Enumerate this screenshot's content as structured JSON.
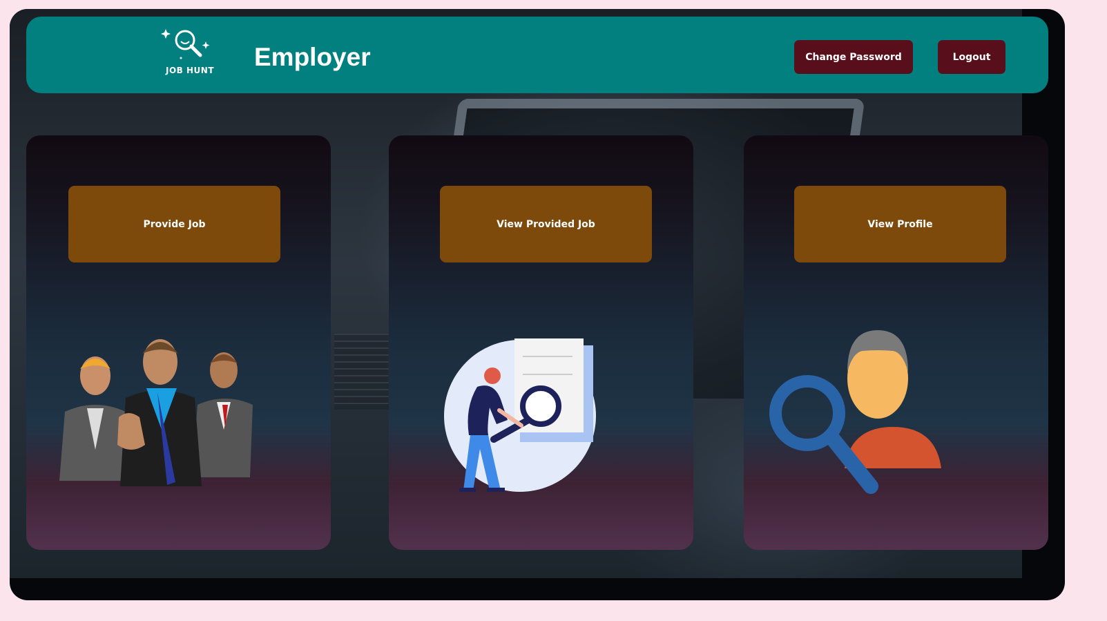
{
  "header": {
    "logo_text": "JOB HUNT",
    "title": "Employer",
    "change_password_label": "Change Password",
    "logout_label": "Logout"
  },
  "cards": [
    {
      "label": "Provide Job",
      "illustration": "business-team-icon"
    },
    {
      "label": "View Provided Job",
      "illustration": "document-search-icon"
    },
    {
      "label": "View Profile",
      "illustration": "user-search-icon"
    }
  ],
  "colors": {
    "page_bg": "#fce4ec",
    "header_bg": "#028080",
    "header_button_bg": "#590f1b",
    "card_button_bg": "#7d4a0b",
    "text": "#ffffff"
  }
}
